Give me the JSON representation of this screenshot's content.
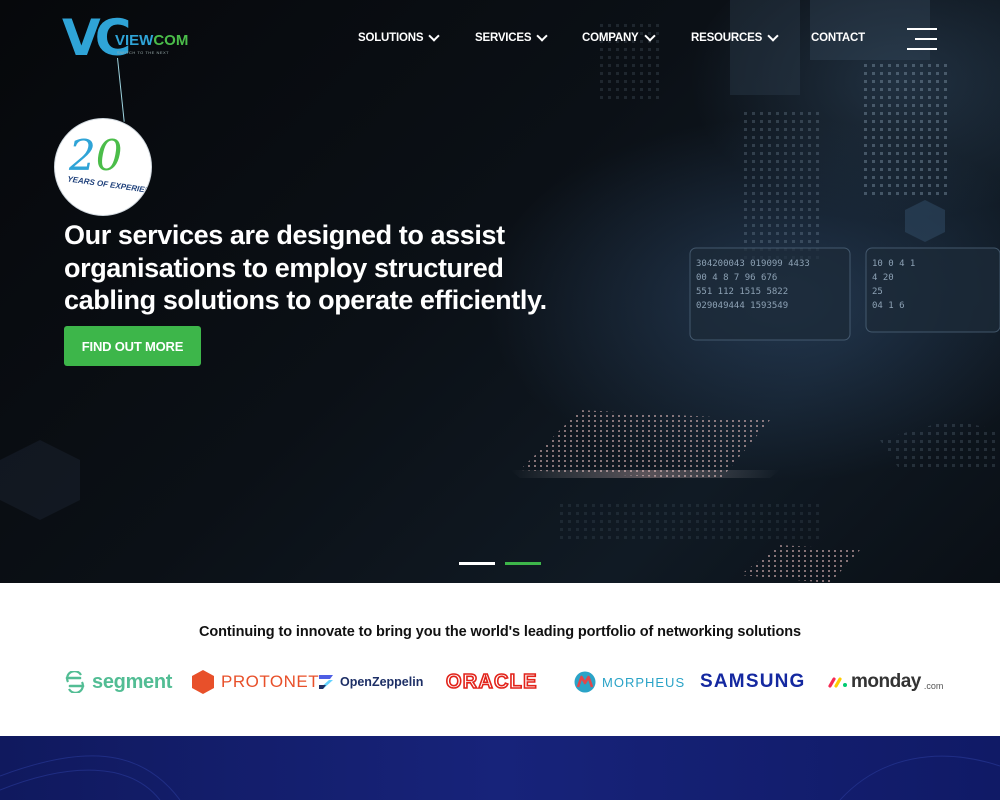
{
  "brand": {
    "logo_mark": "VC",
    "logo_word_a": "VIEW",
    "logo_word_b": "COM",
    "tagline": "SWITCH TO THE NEXT"
  },
  "nav": {
    "items": [
      {
        "label": "SOLUTIONS",
        "has_dropdown": true
      },
      {
        "label": "SERVICES",
        "has_dropdown": true
      },
      {
        "label": "COMPANY",
        "has_dropdown": true
      },
      {
        "label": "RESOURCES",
        "has_dropdown": true
      },
      {
        "label": "CONTACT",
        "has_dropdown": false
      }
    ],
    "menu_icon": "hamburger-menu-icon"
  },
  "badge": {
    "number_a": "2",
    "number_b": "0",
    "caption": "YEARS OF EXPERIENCE"
  },
  "hero": {
    "headline": "Our services are designed to assist organisations to employ structured cabling solutions to operate efficiently.",
    "cta_label": "FIND OUT MORE",
    "slides": 2,
    "active_slide": 2
  },
  "partners": {
    "title": "Continuing to innovate to bring you the world's leading portfolio of networking solutions",
    "logos": [
      {
        "name": "segment",
        "color": "#52bd94"
      },
      {
        "name": "PROTONET",
        "color": "#e8502a"
      },
      {
        "name": "OpenZeppelin",
        "color": "#1d2f66"
      },
      {
        "name": "ORACLE",
        "color": "#e2231a"
      },
      {
        "name": "MORPHEUS",
        "color": "#2aa3c7"
      },
      {
        "name": "SAMSUNG",
        "color": "#1428a0"
      },
      {
        "name": "monday",
        "suffix": ".com",
        "color": "#333333"
      }
    ]
  },
  "colors": {
    "accent_green": "#3db64a",
    "brand_blue": "#2fa4d7",
    "footer_navy": "#141f6e"
  }
}
